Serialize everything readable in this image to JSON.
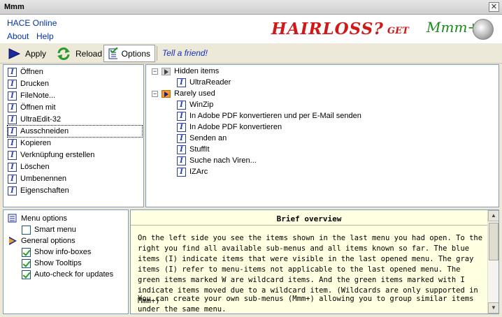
{
  "window": {
    "title": "Mmm",
    "close_glyph": "✕"
  },
  "header": {
    "brand": "HACE Online",
    "menu": [
      "About",
      "Help"
    ],
    "ad": {
      "text1": "HAIRLOSS?",
      "text2": "GET",
      "text3": "Mmm+"
    }
  },
  "toolbar": {
    "apply": "Apply",
    "reload": "Reload",
    "options": "Options",
    "tell": "Tell a friend!"
  },
  "left_items": [
    "Öffnen",
    "Drucken",
    "FileNote...",
    "Öffnen mit",
    "UltraEdit-32",
    "Ausschneiden",
    "Kopieren",
    "Verknüpfung erstellen",
    "Löschen",
    "Umbenennen",
    "Eigenschaften"
  ],
  "tree": {
    "group1": {
      "label": "Hidden items",
      "items": [
        "UltraReader"
      ]
    },
    "group2": {
      "label": "Rarely used",
      "items": [
        "WinZip",
        "In Adobe PDF konvertieren und per E-Mail senden",
        "In Adobe PDF konvertieren",
        "Senden an",
        "StuffIt",
        "Suche nach Viren...",
        "IZArc"
      ]
    }
  },
  "options": {
    "menu_options": "Menu options",
    "smart_menu": "Smart menu",
    "general_options": "General options",
    "show_info_boxes": "Show info-boxes",
    "show_tooltips": "Show Tooltips",
    "auto_check": "Auto-check for updates"
  },
  "overview": {
    "title": "Brief overview",
    "para1": "On the left side you see the items shown in the last menu you had open. To the right you find all available sub-menus and all items known so far. The blue items (I) indicate items that were visible in the last opened menu. The gray items (I) refer to menu-items not applicable to the last opened menu. The green items marked W are wildcard items. And the green items marked with I indicate items moved due to a wildcard item. (Wildcards are only supported in Mmm+)",
    "para2": "You can create your own sub-menus (Mmm+) allowing you to group similar items under the same menu."
  },
  "colors": {
    "accent_blue": "#2a3fa0",
    "link": "#0033aa",
    "ad_red": "#d01818",
    "ad_green": "#1a8a1a",
    "overview_bg": "#ffffe1"
  }
}
